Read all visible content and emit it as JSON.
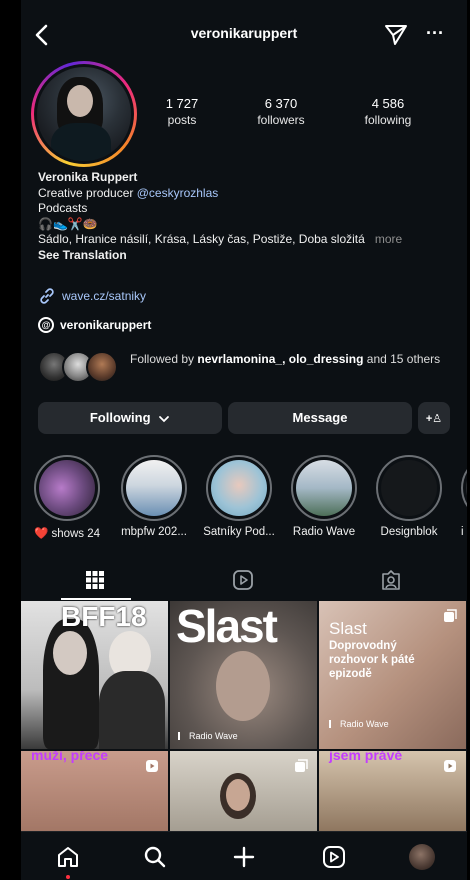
{
  "header": {
    "username": "veronikaruppert",
    "more_glyph": "···",
    "icons": {
      "back": "back-chevron-icon",
      "send": "send-icon",
      "more": "more-icon"
    }
  },
  "stats": [
    {
      "value": "1 727",
      "label": "posts"
    },
    {
      "value": "6 370",
      "label": "followers"
    },
    {
      "value": "4 586",
      "label": "following"
    }
  ],
  "bio": {
    "name": "Veronika Ruppert",
    "line1_prefix": "Creative producer ",
    "line1_handle": "@ceskyrozhlas",
    "line2": "Podcasts",
    "line3": "🎧👟✂️🍩",
    "line4": "Sádlo, Hranice násilí, Krása, Lásky čas, Postiže, Doba složitá",
    "more": "more",
    "see_translation": "See Translation"
  },
  "link": {
    "text": "wave.cz/satniky",
    "icon": "link-icon"
  },
  "threads": {
    "text": "veronikaruppert",
    "icon": "threads-icon",
    "glyph": "@"
  },
  "followed_by": {
    "prefix": "Followed by ",
    "names": "nevrlamonina_, olo_dressing",
    "suffix": " and 15 others"
  },
  "buttons": {
    "following": "Following",
    "following_icon": "chevron-down-icon",
    "message": "Message",
    "add_user_icon": "add-user-icon",
    "add_user_glyph": "+♙"
  },
  "highlights": [
    {
      "label": "❤️ shows 24"
    },
    {
      "label": "mbpfw 202..."
    },
    {
      "label": "Šatníky Pod..."
    },
    {
      "label": "Radio Wave"
    },
    {
      "label": "Designblok"
    },
    {
      "label": "i"
    }
  ],
  "tabs": [
    {
      "name": "posts",
      "icon": "grid-icon"
    },
    {
      "name": "reels",
      "icon": "reels-icon"
    },
    {
      "name": "tagged",
      "icon": "tagged-icon"
    }
  ],
  "posts": [
    {
      "big": "BFF18",
      "label": "",
      "bg": "#d9d9d9"
    },
    {
      "big": "Slast",
      "label": "Radio Wave",
      "bg": "#6a6664"
    },
    {
      "big": "Slast",
      "sub": "Doprovodný rozhovor k páté epizodě",
      "label": "Radio Wave",
      "bg": "#c9a897"
    },
    {
      "big": "muži, přece",
      "label": "",
      "bg": "#b58878"
    },
    {
      "big": "",
      "label": "",
      "bg": "#b9b2a6"
    },
    {
      "big": "jsem právě",
      "label": "",
      "bg": "#b9a690"
    }
  ],
  "navbar": [
    {
      "name": "home",
      "icon": "home-icon"
    },
    {
      "name": "search",
      "icon": "search-icon"
    },
    {
      "name": "create",
      "icon": "plus-icon"
    },
    {
      "name": "reels",
      "icon": "reels-icon"
    },
    {
      "name": "profile",
      "icon": "profile-avatar-icon"
    }
  ],
  "colors": {
    "background": "#0c1014",
    "button": "#262a2f",
    "link": "#a8c7fa",
    "notification": "#ff3040"
  }
}
